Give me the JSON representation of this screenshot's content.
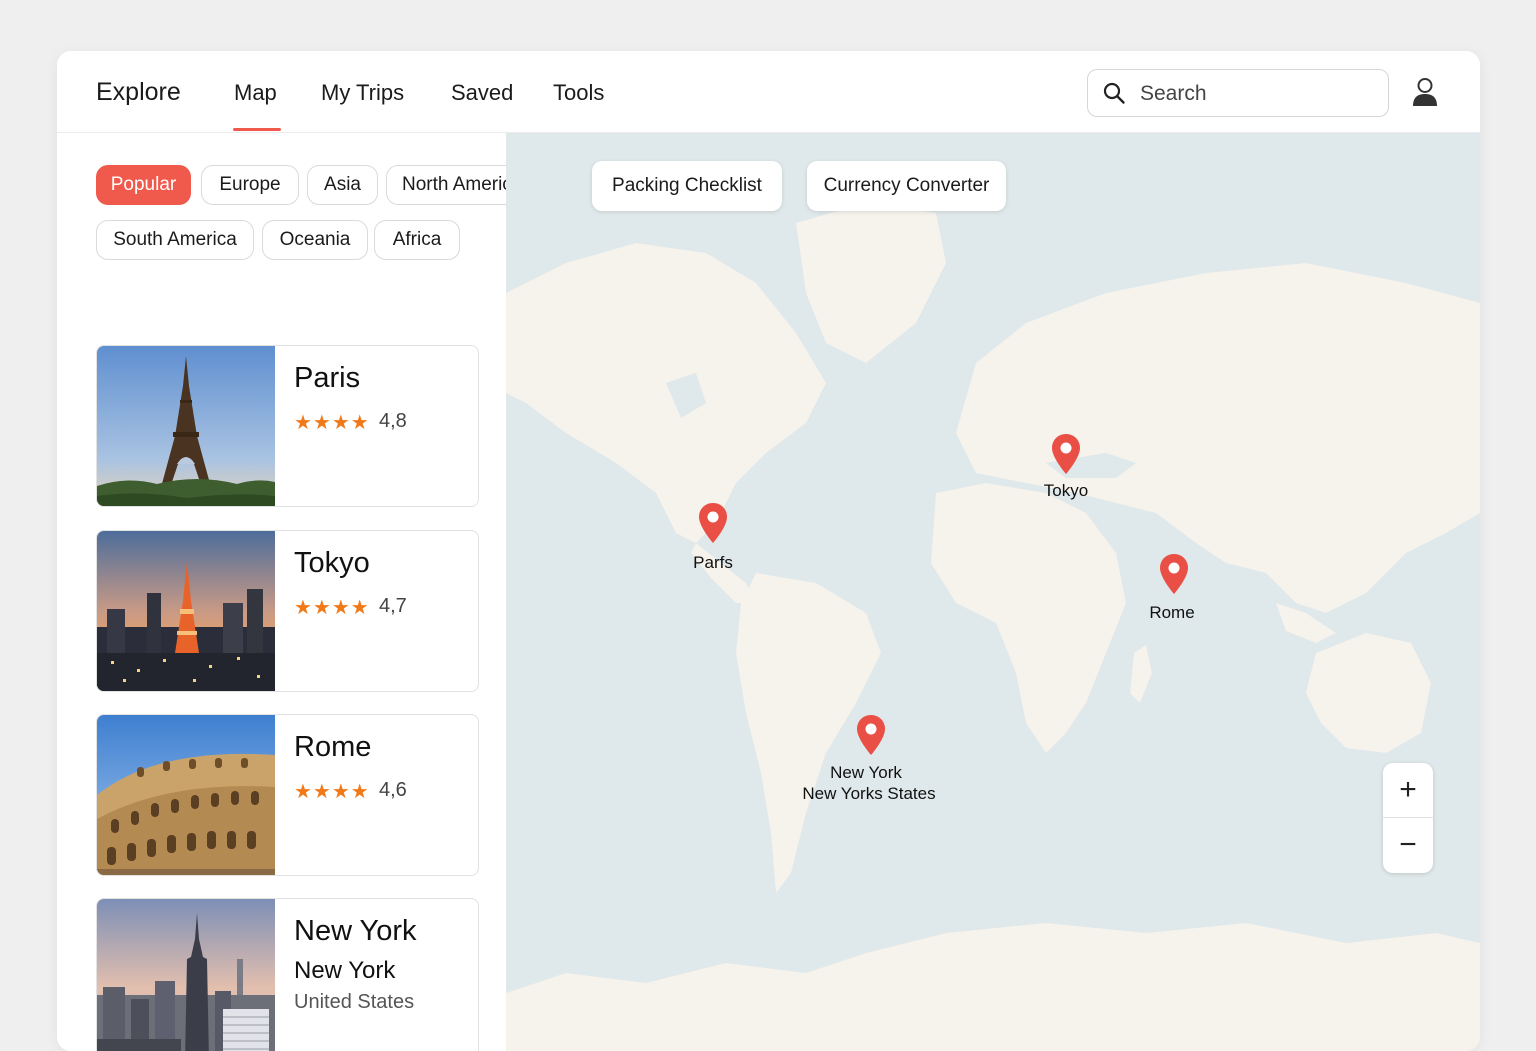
{
  "header": {
    "brand": "Explore",
    "tabs": [
      {
        "label": "Map",
        "active": true
      },
      {
        "label": "My Trips",
        "active": false
      },
      {
        "label": "Saved",
        "active": false
      },
      {
        "label": "Tools",
        "active": false
      }
    ],
    "search_placeholder": "Search"
  },
  "filters": {
    "chips": [
      {
        "label": "Popular",
        "active": true
      },
      {
        "label": "Europe",
        "active": false
      },
      {
        "label": "Asia",
        "active": false
      },
      {
        "label": "North America",
        "active": false
      },
      {
        "label": "South America",
        "active": false
      },
      {
        "label": "Oceania",
        "active": false
      },
      {
        "label": "Africa",
        "active": false
      }
    ]
  },
  "destinations": [
    {
      "name": "Paris",
      "stars": "★★★★",
      "rating": "4,8"
    },
    {
      "name": "Tokyo",
      "stars": "★★★★",
      "rating": "4,7"
    },
    {
      "name": "Rome",
      "stars": "★★★★",
      "rating": "4,6"
    },
    {
      "name": "New York",
      "subtitle": "New York",
      "country": "United States"
    }
  ],
  "map": {
    "tools": [
      "Packing Checklist",
      "Currency Converter"
    ],
    "pins": [
      {
        "label": "Tokyo"
      },
      {
        "label": "Parfs"
      },
      {
        "label": "Rome"
      },
      {
        "label": "New York",
        "label2": "New Yorks States"
      }
    ],
    "zoom_in": "+",
    "zoom_out": "−"
  },
  "colors": {
    "accent": "#ef5a4c",
    "star": "#f07a1a",
    "water": "#dfe8ea",
    "land": "#f6f2ec"
  }
}
